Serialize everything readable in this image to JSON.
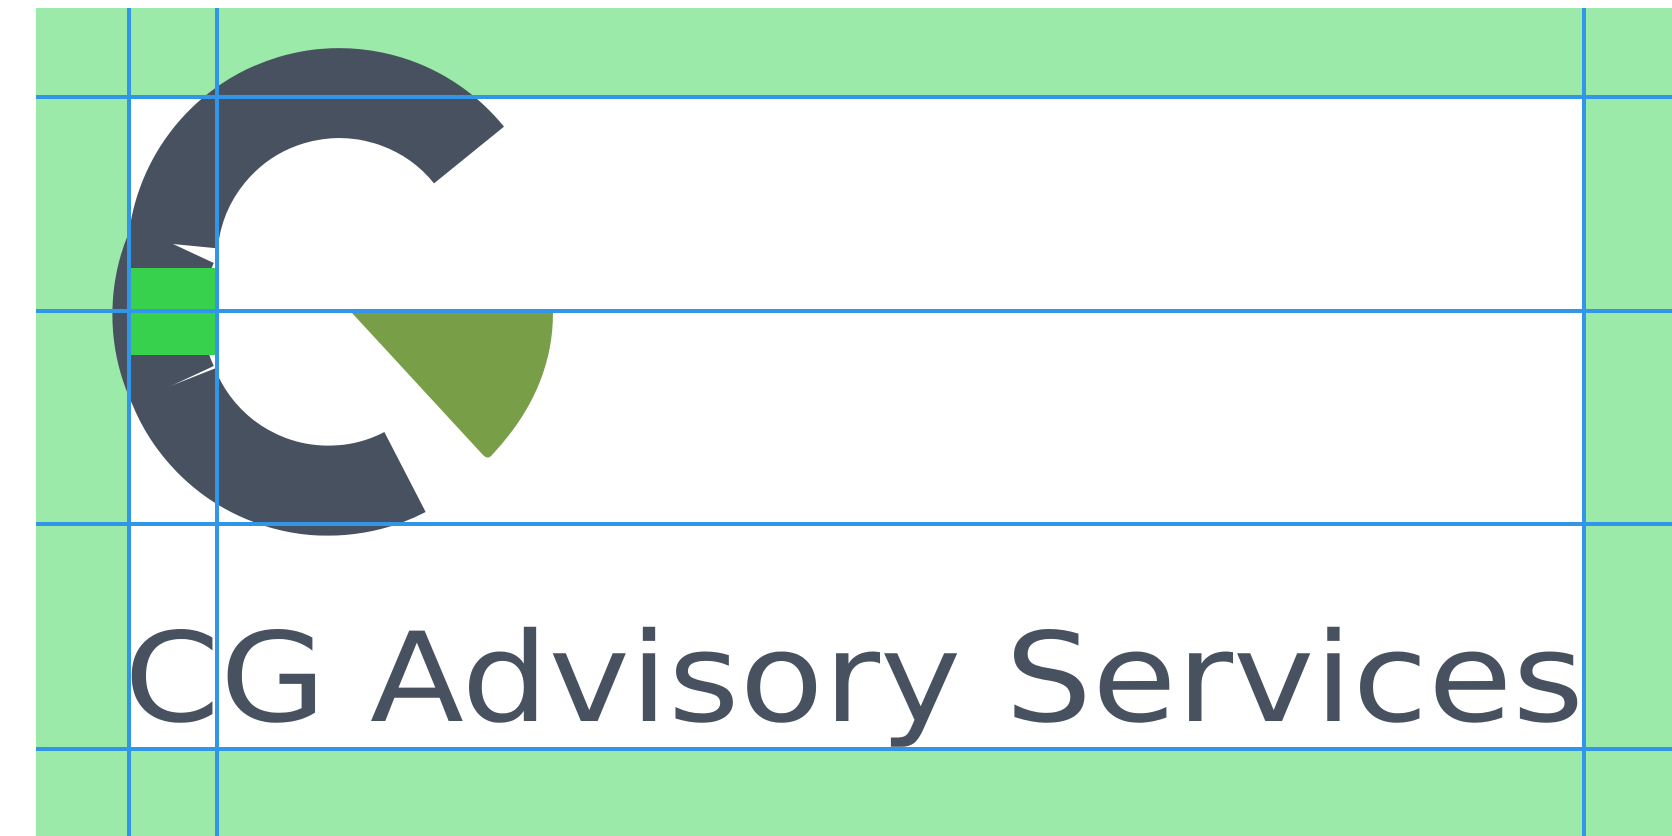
{
  "logo": {
    "wordmark": "CG Advisory Services",
    "mark_letters": "CG"
  },
  "colors": {
    "clear_space": "#9ceaa9",
    "content_area": "#ffffff",
    "guide_lines": "#3196e8",
    "module_square": "#38d14e",
    "mark_dark": "#48515f",
    "mark_accent": "#789f47",
    "wordmark_text": "#48515f"
  }
}
